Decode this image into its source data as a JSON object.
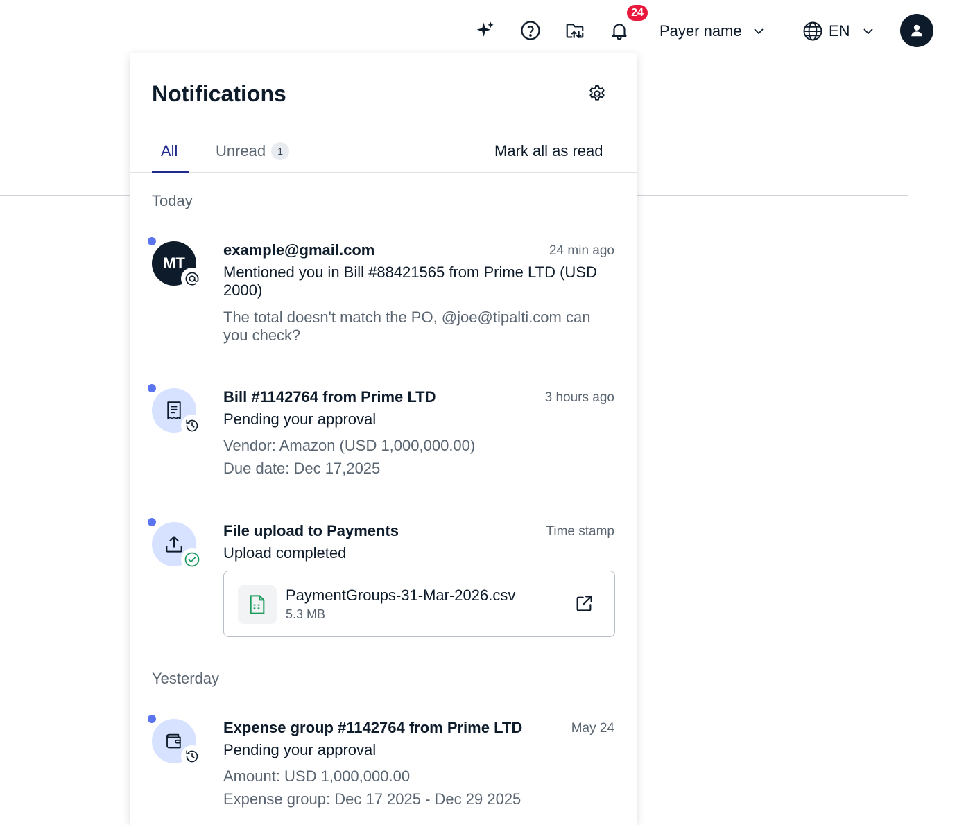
{
  "header": {
    "notification_count": "24",
    "payer_name": "Payer name",
    "language": "EN",
    "icons": [
      "sparkles-icon",
      "help-icon",
      "folder-upload-icon",
      "bell-icon",
      "globe-icon",
      "user-icon"
    ]
  },
  "panel": {
    "title": "Notifications",
    "tabs": [
      {
        "label": "All",
        "active": true
      },
      {
        "label": "Unread",
        "count": "1"
      }
    ],
    "mark_all_label": "Mark all as read",
    "sections": {
      "today": "Today",
      "yesterday": "Yesterday"
    },
    "notifications": [
      {
        "avatar_initials": "MT",
        "title": "example@gmail.com",
        "time": "24 min ago",
        "line": "Mentioned you in Bill #88421565 from Prime LTD (USD 2000)",
        "sub": "The total doesn't match the PO, @joe@tipalti.com can you check?"
      },
      {
        "title": "Bill #1142764 from Prime LTD",
        "time": "3 hours ago",
        "line": "Pending your approval",
        "sub1": "Vendor: Amazon (USD 1,000,000.00)",
        "sub2": "Due date: Dec 17,2025"
      },
      {
        "title": "File upload to Payments",
        "time": "Time stamp",
        "line": "Upload completed",
        "file": {
          "name": "PaymentGroups-31-Mar-2026.csv",
          "size": "5.3 MB"
        }
      },
      {
        "title": "Expense group #1142764 from Prime LTD",
        "time": "May 24",
        "line": "Pending your approval",
        "sub1": "Amount: USD 1,000,000.00",
        "sub2": "Expense group: Dec 17 2025 - Dec 29 2025"
      }
    ]
  },
  "colors": {
    "accent": "#1f2b8f",
    "unread_dot": "#5b74f0",
    "badge": "#e8193c",
    "icon_bg": "#d6e2ff",
    "dark": "#0d1b2a",
    "success": "#1a9a5c"
  }
}
